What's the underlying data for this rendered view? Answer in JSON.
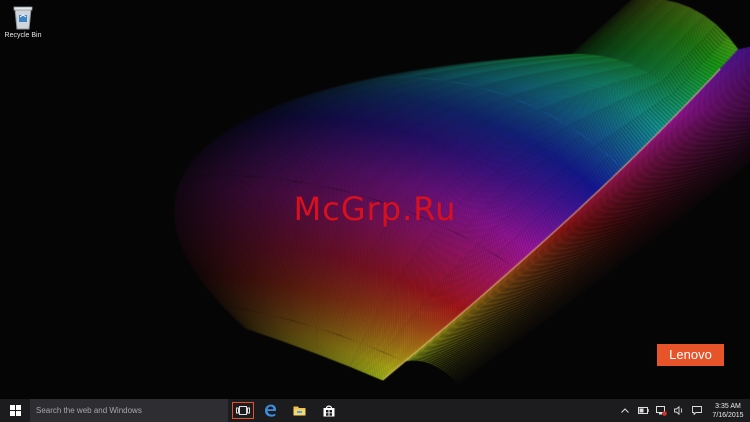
{
  "desktop": {
    "icons": [
      {
        "label": "Recycle Bin",
        "icon": "recycle-bin-icon"
      }
    ],
    "watermark": "McGrp.Ru",
    "brand_badge": {
      "text": "Lenovo",
      "color": "#e8542a"
    }
  },
  "taskbar": {
    "start_icon": "windows-logo-icon",
    "search": {
      "placeholder": "Search the web and Windows"
    },
    "task_view_icon": "task-view-icon",
    "pinned": [
      {
        "icon": "edge-browser-icon"
      },
      {
        "icon": "file-explorer-icon"
      },
      {
        "icon": "store-icon"
      }
    ],
    "tray": {
      "icons": [
        "chevron-up-icon",
        "battery-icon",
        "network-icon",
        "volume-icon",
        "action-center-icon"
      ],
      "time": "3:35 AM",
      "date": "7/16/2015"
    },
    "accent_color": "#e5512a"
  }
}
